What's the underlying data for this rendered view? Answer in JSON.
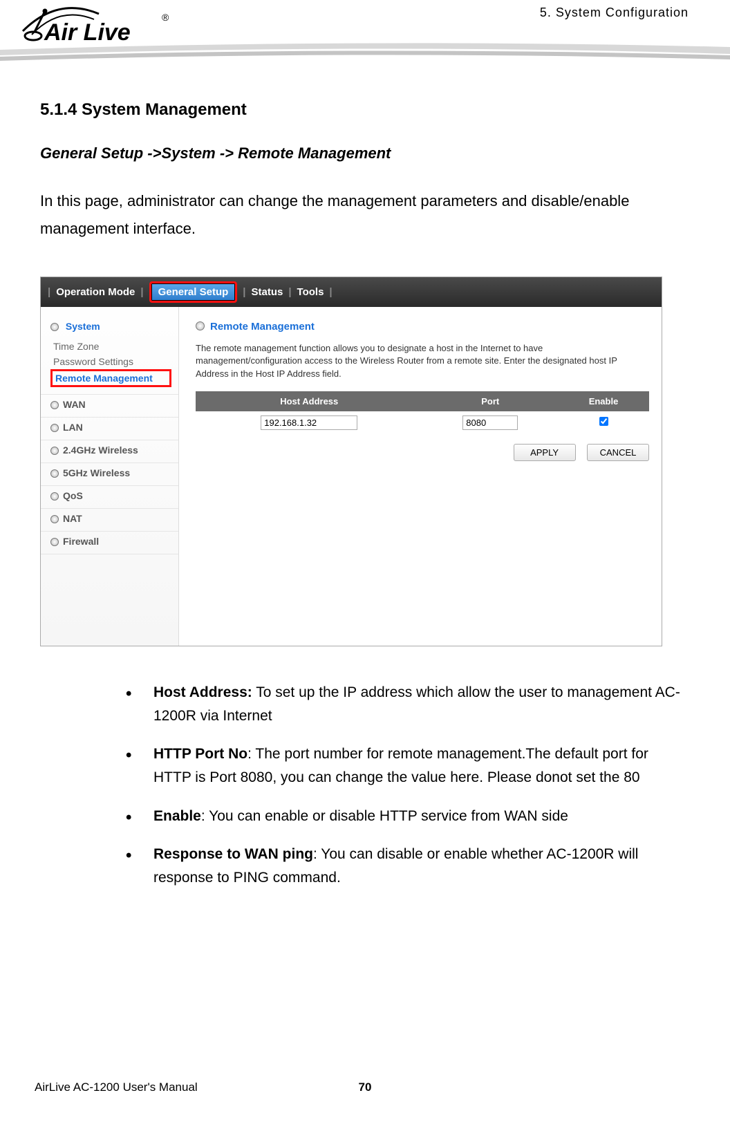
{
  "header": {
    "chapter": "5.  System  Configuration",
    "logo_text": "Air Live",
    "logo_trademark": "®"
  },
  "section": {
    "heading": "5.1.4 System Management",
    "breadcrumb": "General Setup ->System -> Remote Management",
    "intro": "In this page, administrator can change the management parameters and disable/enable management interface."
  },
  "figure": {
    "tabs": {
      "op_mode": "Operation Mode",
      "general": "General Setup",
      "status": "Status",
      "tools": "Tools"
    },
    "sidebar": {
      "system_label": "System",
      "sub": {
        "tz": "Time Zone",
        "pw": "Password Settings",
        "rm": "Remote Management"
      },
      "cats": {
        "wan": "WAN",
        "lan": "LAN",
        "w24": "2.4GHz Wireless",
        "w5": "5GHz Wireless",
        "qos": "QoS",
        "nat": "NAT",
        "fw": "Firewall"
      }
    },
    "panel": {
      "title": "Remote Management",
      "desc": "The remote management function allows you to designate a host in the Internet to have management/configuration access to the Wireless Router from a remote site. Enter the designated host IP Address in the Host IP Address field.",
      "th_host": "Host Address",
      "th_port": "Port",
      "th_enable": "Enable",
      "val_host": "192.168.1.32",
      "val_port": "8080",
      "btn_apply": "APPLY",
      "btn_cancel": "CANCEL"
    }
  },
  "bullets": {
    "b1_label": "Host Address:",
    "b1_text": " To set up the IP address which allow the user to management AC-1200R via Internet",
    "b2_label": "HTTP Port No",
    "b2_text": ": The port number for remote management.The default port for HTTP is Port 8080, you can change the value here. Please donot set the 80",
    "b3_label": "Enable",
    "b3_text": ": You can enable or disable HTTP service from WAN side",
    "b4_label": "Response to WAN ping",
    "b4_text": ": You can disable or enable whether AC-1200R will response to PING command."
  },
  "footer": {
    "manual": "AirLive AC-1200 User's Manual",
    "page": "70"
  }
}
